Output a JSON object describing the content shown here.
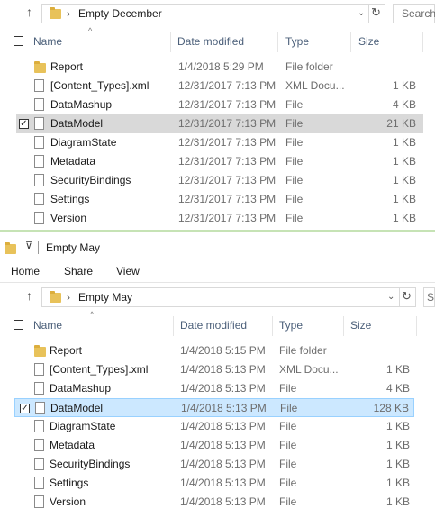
{
  "window1": {
    "breadcrumb": "Empty December",
    "search_placeholder": "Search",
    "columns": {
      "name": "Name",
      "date": "Date modified",
      "type": "Type",
      "size": "Size"
    },
    "files": [
      {
        "name": "Report",
        "date": "1/4/2018 5:29 PM",
        "type": "File folder",
        "size": "",
        "icon": "folder-icon"
      },
      {
        "name": "[Content_Types].xml",
        "date": "12/31/2017 7:13 PM",
        "type": "XML Docu...",
        "size": "1 KB",
        "icon": "file-icon"
      },
      {
        "name": "DataMashup",
        "date": "12/31/2017 7:13 PM",
        "type": "File",
        "size": "4 KB",
        "icon": "file-icon"
      },
      {
        "name": "DataModel",
        "date": "12/31/2017 7:13 PM",
        "type": "File",
        "size": "21 KB",
        "icon": "file-icon",
        "selected": true
      },
      {
        "name": "DiagramState",
        "date": "12/31/2017 7:13 PM",
        "type": "File",
        "size": "1 KB",
        "icon": "file-icon"
      },
      {
        "name": "Metadata",
        "date": "12/31/2017 7:13 PM",
        "type": "File",
        "size": "1 KB",
        "icon": "file-icon"
      },
      {
        "name": "SecurityBindings",
        "date": "12/31/2017 7:13 PM",
        "type": "File",
        "size": "1 KB",
        "icon": "file-icon"
      },
      {
        "name": "Settings",
        "date": "12/31/2017 7:13 PM",
        "type": "File",
        "size": "1 KB",
        "icon": "file-icon"
      },
      {
        "name": "Version",
        "date": "12/31/2017 7:13 PM",
        "type": "File",
        "size": "1 KB",
        "icon": "file-icon"
      }
    ]
  },
  "window2": {
    "title": "Empty May",
    "ribbon_tabs": [
      "Home",
      "Share",
      "View"
    ],
    "breadcrumb": "Empty May",
    "search_placeholder": "S",
    "columns": {
      "name": "Name",
      "date": "Date modified",
      "type": "Type",
      "size": "Size"
    },
    "files": [
      {
        "name": "Report",
        "date": "1/4/2018 5:15 PM",
        "type": "File folder",
        "size": "",
        "icon": "folder-icon"
      },
      {
        "name": "[Content_Types].xml",
        "date": "1/4/2018 5:13 PM",
        "type": "XML Docu...",
        "size": "1 KB",
        "icon": "file-icon"
      },
      {
        "name": "DataMashup",
        "date": "1/4/2018 5:13 PM",
        "type": "File",
        "size": "4 KB",
        "icon": "file-icon"
      },
      {
        "name": "DataModel",
        "date": "1/4/2018 5:13 PM",
        "type": "File",
        "size": "128 KB",
        "icon": "file-icon",
        "selected": true
      },
      {
        "name": "DiagramState",
        "date": "1/4/2018 5:13 PM",
        "type": "File",
        "size": "1 KB",
        "icon": "file-icon"
      },
      {
        "name": "Metadata",
        "date": "1/4/2018 5:13 PM",
        "type": "File",
        "size": "1 KB",
        "icon": "file-icon"
      },
      {
        "name": "SecurityBindings",
        "date": "1/4/2018 5:13 PM",
        "type": "File",
        "size": "1 KB",
        "icon": "file-icon"
      },
      {
        "name": "Settings",
        "date": "1/4/2018 5:13 PM",
        "type": "File",
        "size": "1 KB",
        "icon": "file-icon"
      },
      {
        "name": "Version",
        "date": "1/4/2018 5:13 PM",
        "type": "File",
        "size": "1 KB",
        "icon": "file-icon"
      }
    ]
  },
  "colors": {
    "selected_gray": "#d9d9d9",
    "selected_blue": "#cce8ff",
    "header_text": "#4c607a",
    "divider_green": "#c6e3b5"
  }
}
